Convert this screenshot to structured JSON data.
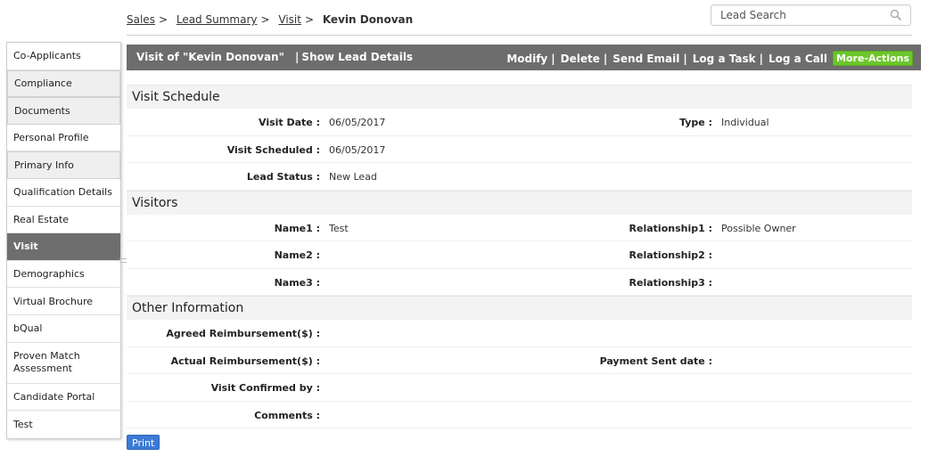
{
  "breadcrumb": {
    "items": [
      "Sales",
      "Lead Summary",
      "Visit"
    ],
    "current": "Kevin Donovan"
  },
  "search": {
    "placeholder": "Lead Search"
  },
  "sidebar": {
    "items": [
      {
        "label": "Co-Applicants"
      },
      {
        "label": "Compliance"
      },
      {
        "label": "Documents"
      },
      {
        "label": "Personal Profile"
      },
      {
        "label": "Primary Info"
      },
      {
        "label": "Qualification Details"
      },
      {
        "label": "Real Estate"
      },
      {
        "label": "Visit"
      },
      {
        "label": "Demographics"
      },
      {
        "label": "Virtual Brochure"
      },
      {
        "label": "bQual"
      },
      {
        "label": "Proven Match Assessment"
      },
      {
        "label": "Candidate Portal"
      },
      {
        "label": "Test"
      }
    ]
  },
  "action_bar": {
    "title": "Visit of \"Kevin Donovan\"",
    "separator": "|",
    "show_lead_details": "Show Lead Details",
    "actions": [
      "Modify",
      "Delete",
      "Send Email",
      "Log a Task",
      "Log a Call"
    ],
    "more_actions": "More-Actions"
  },
  "sections": {
    "visit_schedule": {
      "title": "Visit Schedule",
      "visit_date_label": "Visit Date :",
      "visit_date_value": "06/05/2017",
      "type_label": "Type :",
      "type_value": "Individual",
      "visit_scheduled_label": "Visit Scheduled :",
      "visit_scheduled_value": "06/05/2017",
      "lead_status_label": "Lead Status :",
      "lead_status_value": "New Lead"
    },
    "visitors": {
      "title": "Visitors",
      "name1_label": "Name1 :",
      "name1_value": "Test",
      "relationship1_label": "Relationship1 :",
      "relationship1_value": "Possible Owner",
      "name2_label": "Name2 :",
      "relationship2_label": "Relationship2 :",
      "name3_label": "Name3 :",
      "relationship3_label": "Relationship3 :"
    },
    "other": {
      "title": "Other Information",
      "agreed_label": "Agreed Reimbursement($) :",
      "actual_label": "Actual Reimbursement($) :",
      "payment_label": "Payment Sent date :",
      "confirmed_label": "Visit Confirmed by :",
      "comments_label": "Comments :"
    }
  },
  "print_label": "Print",
  "colors": {
    "action_bar": "#6d6d6d",
    "more_actions": "#6cc62c",
    "print_button": "#3c7bd6",
    "active_sidebar": "#6e6e6e"
  }
}
